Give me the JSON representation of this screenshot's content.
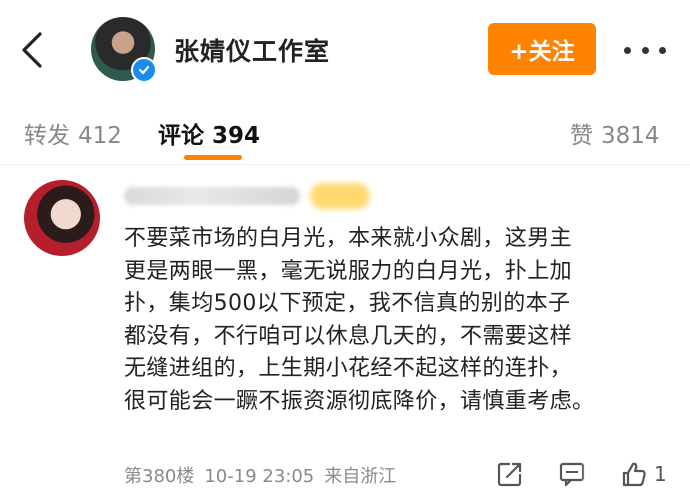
{
  "header": {
    "account_name": "张婧仪工作室",
    "follow_label": "+关注"
  },
  "tabs": [
    {
      "label": "转发",
      "count": "412"
    },
    {
      "label": "评论",
      "count": "394"
    },
    {
      "label": "赞",
      "count": "3814"
    }
  ],
  "comment": {
    "text_lines": [
      "不要菜市场的白月光，本来就小众剧，这男主",
      "更是两眼一黑，毫无说服力的白月光，扑上加",
      "扑，集均500以下预定，我不信真的别的本子",
      "都没有，不行咱可以休息几天的，不需要这样",
      "无缝进组的，上生期小花经不起这样的连扑，",
      "很可能会一蹶不振资源彻底降价，请慎重考虑。"
    ],
    "floor": "第380楼",
    "time": "10-19 23:05",
    "location": "来自浙江",
    "like_count": "1"
  },
  "colors": {
    "accent": "#ff8200",
    "verified": "#1a8cf0"
  }
}
